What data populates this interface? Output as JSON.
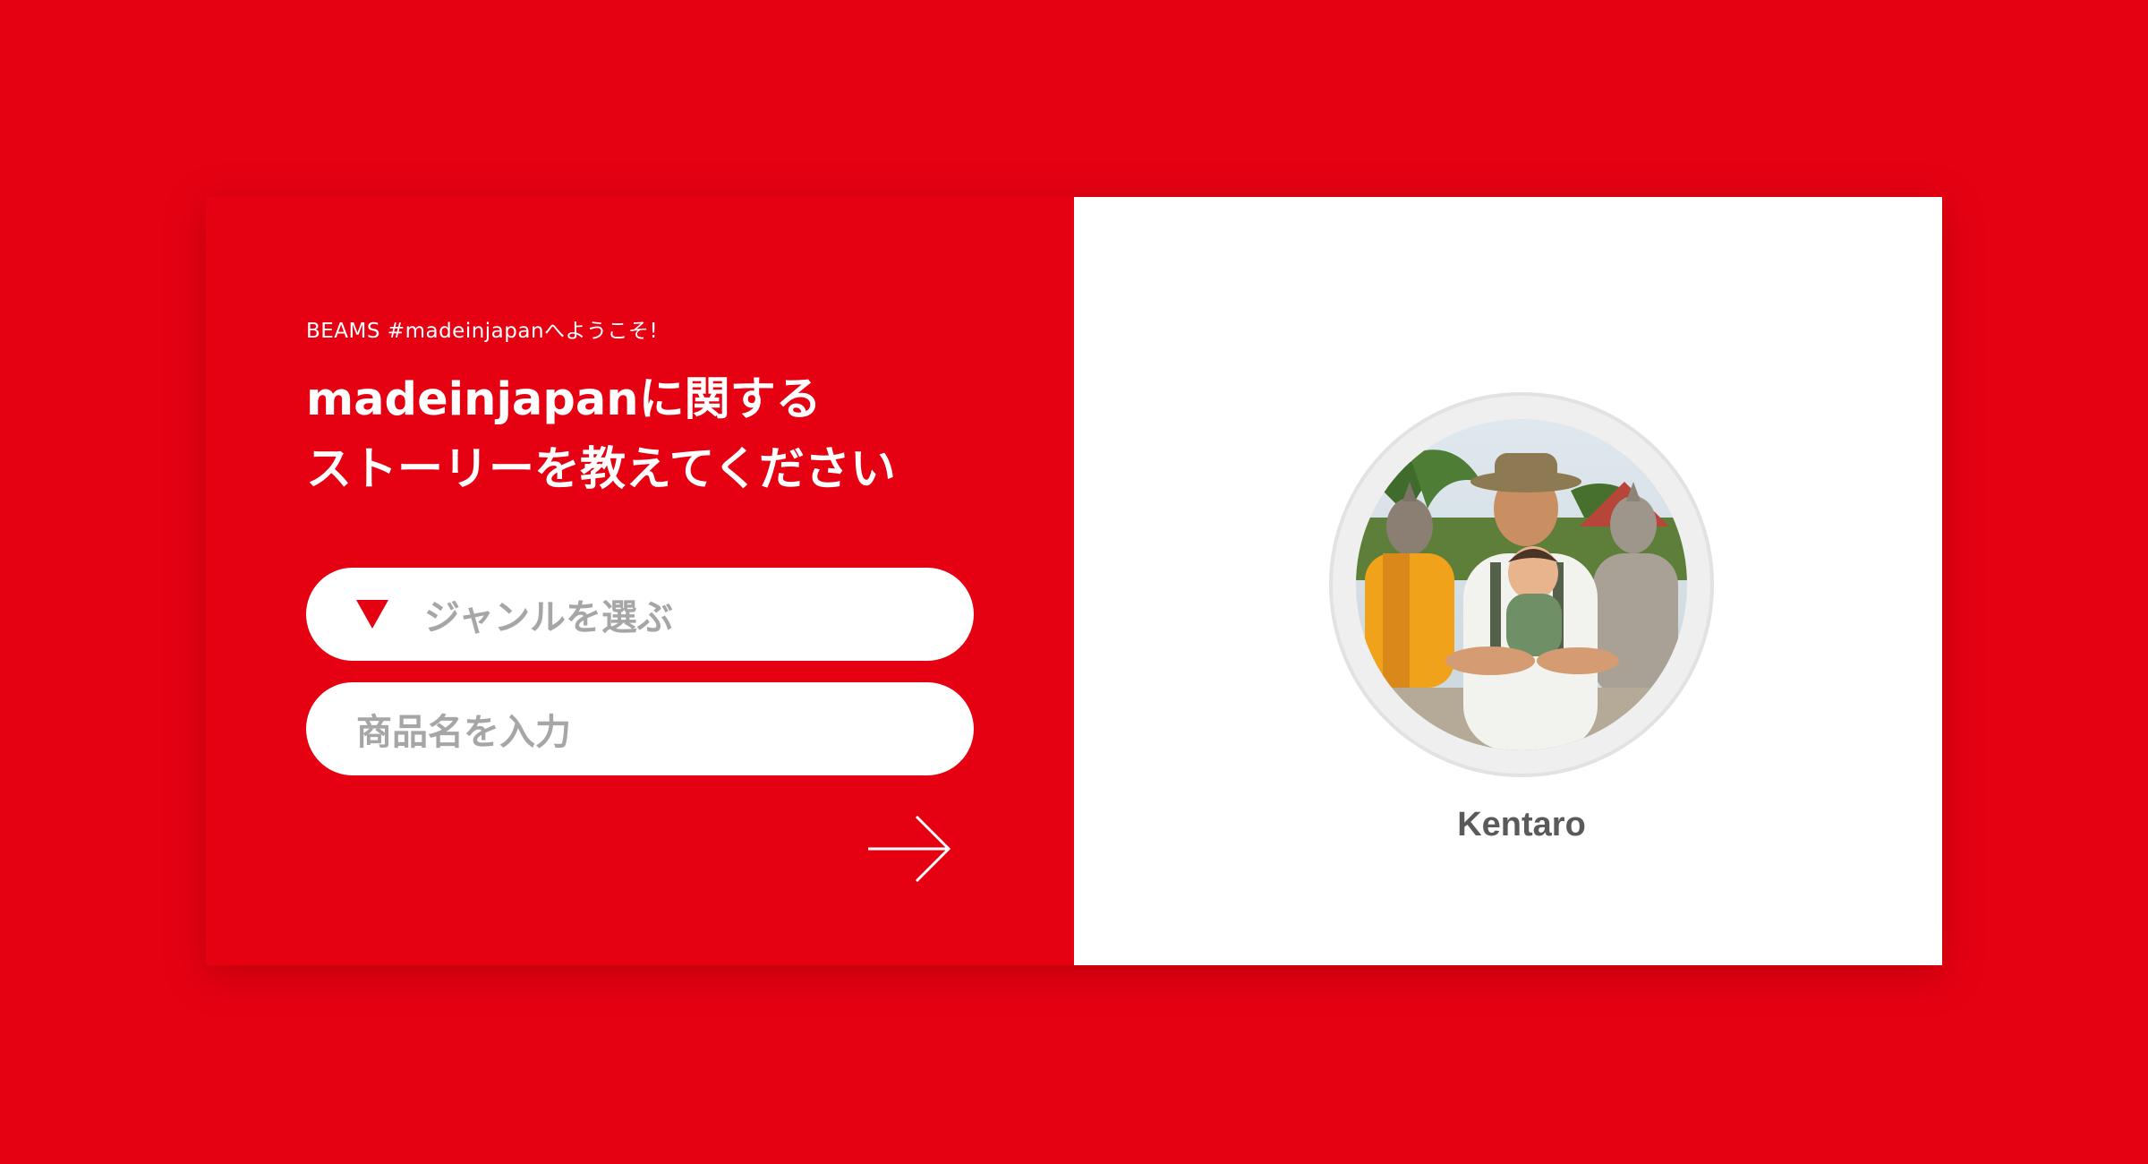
{
  "intro": {
    "welcome": "BEAMS #madeinjapanへようこそ!",
    "headline_line1": "madeinjapanに関する",
    "headline_line2": "ストーリーを教えてください"
  },
  "form": {
    "genre_select": {
      "icon": "triangle-down-icon",
      "placeholder": "ジャンルを選ぶ"
    },
    "product_input": {
      "placeholder": "商品名を入力"
    },
    "submit_icon": "arrow-right-icon"
  },
  "profile": {
    "name": "Kentaro",
    "avatar": "profile-photo"
  },
  "colors": {
    "brand_red": "#e50012",
    "placeholder_gray": "#a6a6a6",
    "name_gray": "#5a5a5a"
  }
}
